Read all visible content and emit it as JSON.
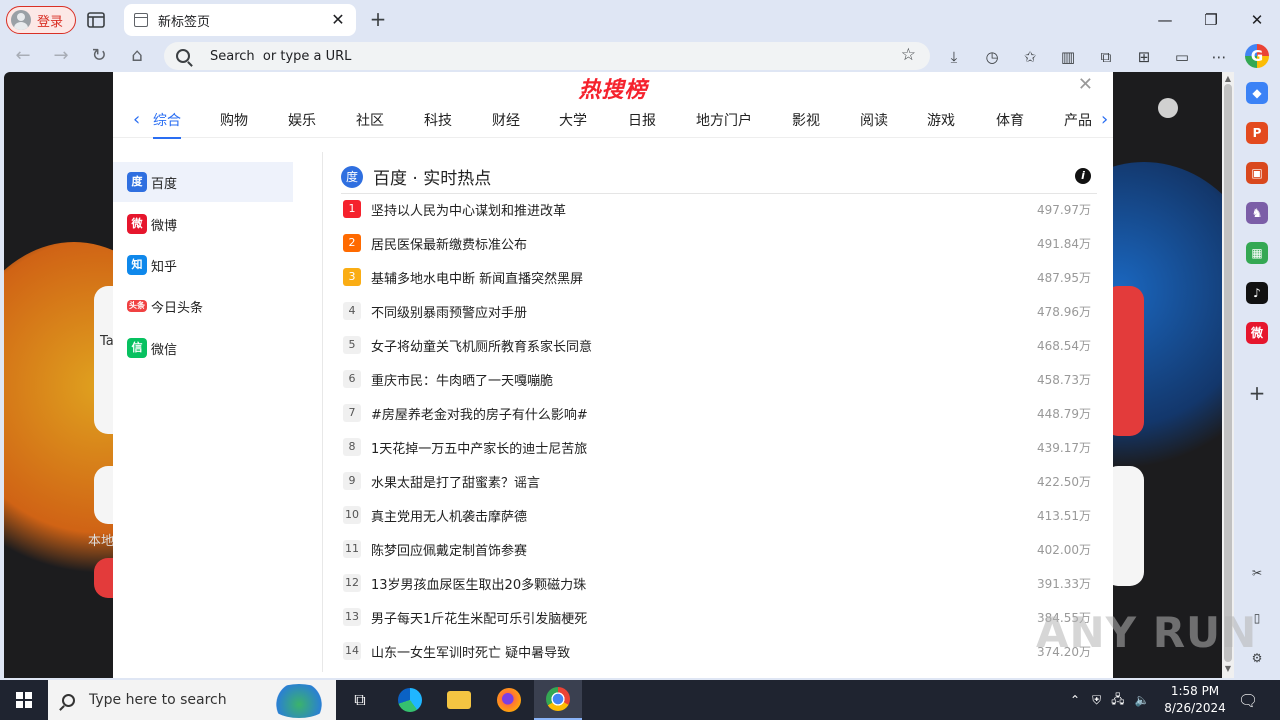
{
  "browser": {
    "profile_label": "登录",
    "tab_title": "新标签页",
    "omnibox_placeholder": "Search  or type a URL"
  },
  "panel": {
    "title": "热搜榜",
    "categories": [
      "综合",
      "购物",
      "娱乐",
      "社区",
      "科技",
      "财经",
      "大学",
      "日报",
      "地方门户",
      "影视",
      "阅读",
      "游戏",
      "体育",
      "产品"
    ],
    "active_category": "综合",
    "sources": [
      {
        "label": "百度",
        "icon": "baidu-icon",
        "color": "#2f6fe0",
        "glyph": "度"
      },
      {
        "label": "微博",
        "icon": "weibo-icon",
        "color": "#e6162d",
        "glyph": "微"
      },
      {
        "label": "知乎",
        "icon": "zhihu-icon",
        "color": "#0f88eb",
        "glyph": "知"
      },
      {
        "label": "今日头条",
        "icon": "toutiao-icon",
        "color": "#f04142",
        "glyph": "头条"
      },
      {
        "label": "微信",
        "icon": "wechat-icon",
        "color": "#07c160",
        "glyph": "信"
      }
    ],
    "list_title": "百度 · 实时热点",
    "items": [
      {
        "rank": "1",
        "title": "坚持以人民为中心谋划和推进改革",
        "heat": "497.97万"
      },
      {
        "rank": "2",
        "title": "居民医保最新缴费标准公布",
        "heat": "491.84万"
      },
      {
        "rank": "3",
        "title": "基辅多地水电中断 新闻直播突然黑屏",
        "heat": "487.95万"
      },
      {
        "rank": "4",
        "title": "不同级别暴雨预警应对手册",
        "heat": "478.96万"
      },
      {
        "rank": "5",
        "title": "女子将幼童关飞机厕所教育系家长同意",
        "heat": "468.54万"
      },
      {
        "rank": "6",
        "title": "重庆市民：牛肉晒了一天嘎嘣脆",
        "heat": "458.73万"
      },
      {
        "rank": "7",
        "title": "#房屋养老金对我的房子有什么影响#",
        "heat": "448.79万"
      },
      {
        "rank": "8",
        "title": "1天花掉一万五中产家长的迪士尼苦旅",
        "heat": "439.17万"
      },
      {
        "rank": "9",
        "title": "水果太甜是打了甜蜜素？谣言",
        "heat": "422.50万"
      },
      {
        "rank": "10",
        "title": "真主党用无人机袭击摩萨德",
        "heat": "413.51万"
      },
      {
        "rank": "11",
        "title": "陈梦回应佩戴定制首饰参赛",
        "heat": "402.00万"
      },
      {
        "rank": "12",
        "title": "13岁男孩血尿医生取出20多颗磁力珠",
        "heat": "391.33万"
      },
      {
        "rank": "13",
        "title": "男子每天1斤花生米配可乐引发脑梗死",
        "heat": "384.55万"
      },
      {
        "rank": "14",
        "title": "山东一女生军训时死亡 疑中暑导致",
        "heat": "374.20万"
      }
    ]
  },
  "background": {
    "partial_texts": [
      "Ta",
      "本地"
    ]
  },
  "watermark": "ANY RUN",
  "taskbar": {
    "search_placeholder": "Type here to search",
    "time": "1:58 PM",
    "date": "8/26/2024"
  }
}
